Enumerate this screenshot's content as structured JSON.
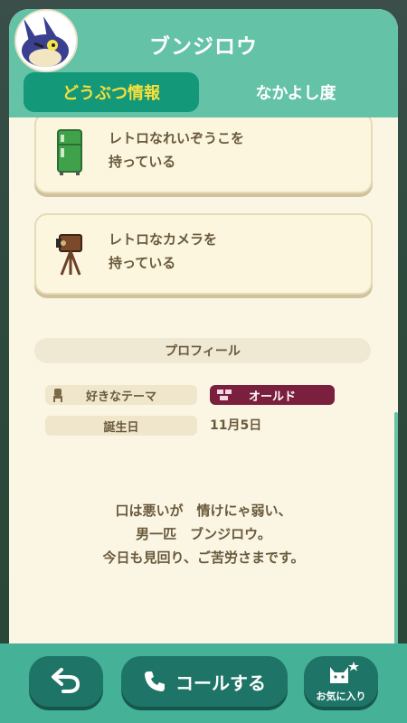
{
  "header": {
    "title": "ブンジロウ",
    "avatar_icon": "villager-avatar-icon"
  },
  "tabs": [
    {
      "label": "どうぶつ情報",
      "active": true
    },
    {
      "label": "なかよし度",
      "active": false
    }
  ],
  "items": [
    {
      "label": "レトロなれいぞうこを\n持っている",
      "icon": "fridge-icon"
    },
    {
      "label": "レトロなカメラを\n持っている",
      "icon": "camera-icon"
    }
  ],
  "profile": {
    "section_title": "プロフィール",
    "theme_label": "好きなテーマ",
    "theme_value": "オールド",
    "birthday_label": "誕生日",
    "birthday_value": "11月5日"
  },
  "quote": "口は悪いが　情けにゃ弱い、\n男一匹　ブンジロウ。\n今日も見回り、ご苦労さまです。",
  "bottom": {
    "back_icon": "back-arrow-icon",
    "call_label": "コールする",
    "fav_label": "お気に入り"
  },
  "colors": {
    "accent": "#64c2a6",
    "tab_active_bg": "#13987a",
    "tab_active_text": "#f8df3a",
    "theme_badge": "#7a1f3d",
    "button": "#1e7467"
  }
}
